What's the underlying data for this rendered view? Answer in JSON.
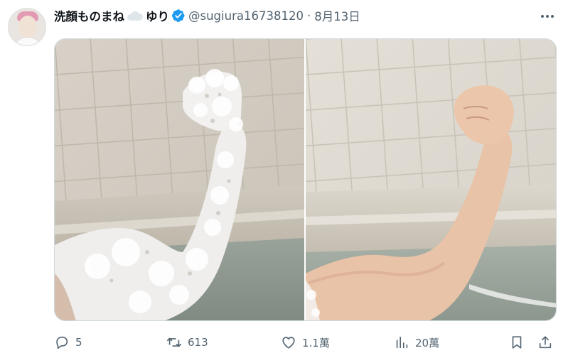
{
  "tweet": {
    "author": {
      "display_name": "洗顔ものまね",
      "name_suffix": "ゆり",
      "handle": "@sugiura16738120",
      "verified": true
    },
    "separator": "·",
    "date": "8月13日",
    "media": [
      {
        "icon": "photo-lathered-arm"
      },
      {
        "icon": "photo-bare-arm"
      }
    ],
    "actions": {
      "reply_count": "5",
      "retweet_count": "613",
      "like_count": "1.1萬",
      "views_count": "20萬"
    },
    "colors": {
      "text_primary": "#0f1419",
      "text_secondary": "#536471",
      "verified_badge": "#1d9bf0",
      "border": "#cfd9de"
    }
  }
}
